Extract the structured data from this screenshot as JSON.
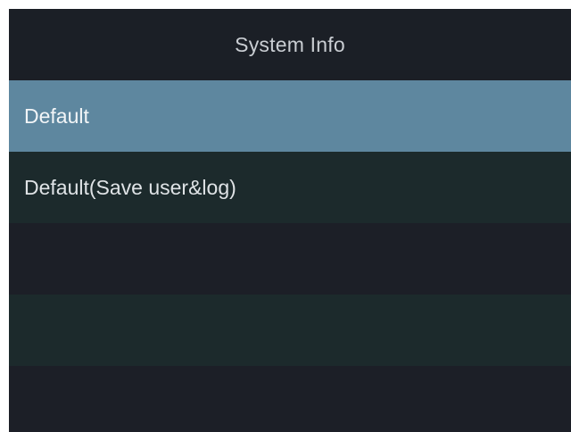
{
  "header": {
    "title": "System Info"
  },
  "menu": {
    "items": [
      {
        "label": "Default",
        "selected": true
      },
      {
        "label": "Default(Save user&log)",
        "selected": false
      },
      {
        "label": "",
        "selected": false
      },
      {
        "label": "",
        "selected": false
      },
      {
        "label": "",
        "selected": false
      }
    ]
  },
  "colors": {
    "background": "#1c1f26",
    "selected_row": "#5e879f",
    "alternate_row": "#1c2a2c",
    "text": "#dfe3e6"
  }
}
